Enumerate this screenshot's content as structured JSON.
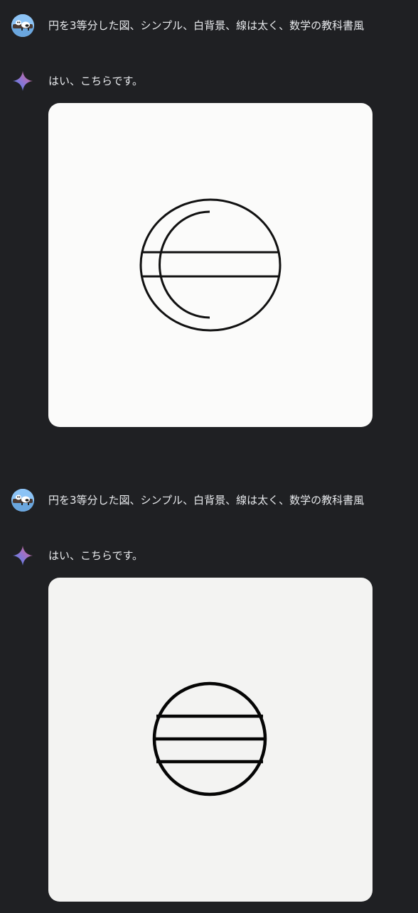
{
  "conversation": [
    {
      "user": {
        "prompt": "円を3等分した図、シンプル、白背景、線は太く、数学の教科書風",
        "avatar_icon": "user-avatar-icon"
      },
      "model": {
        "icon": "gemini-sparkle-icon",
        "reply": "はい、こちらです。",
        "image": {
          "background": "#fbfbfa",
          "stroke": "#111111"
        }
      }
    },
    {
      "user": {
        "prompt": "円を3等分した図、シンプル、白背景、線は太く、数学の教科書風",
        "avatar_icon": "user-avatar-icon"
      },
      "model": {
        "icon": "gemini-sparkle-icon",
        "reply": "はい、こちらです。",
        "image": {
          "background": "#f3f3f2",
          "stroke": "#050505"
        }
      }
    }
  ],
  "theme": {
    "background": "#1f2023",
    "text": "#e8eaed",
    "sparkle_gradient": [
      "#4285f4",
      "#9b72cb",
      "#d96570"
    ]
  }
}
